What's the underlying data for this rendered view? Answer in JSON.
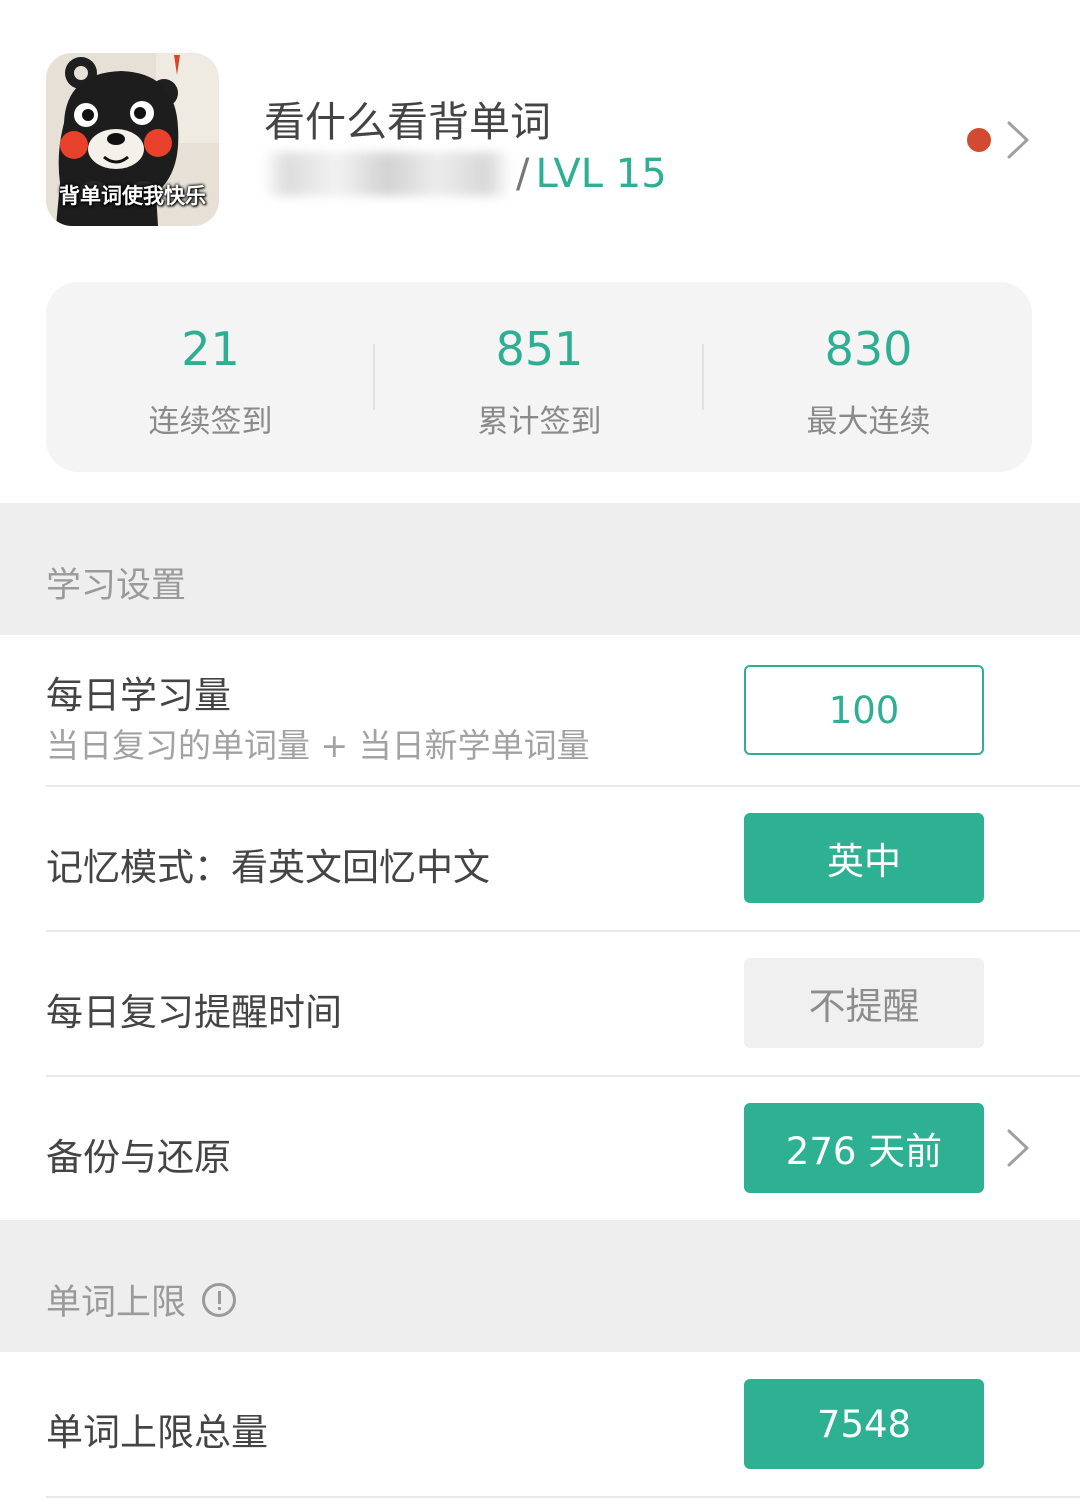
{
  "profile": {
    "avatar_caption": "背单词使我快乐",
    "nickname": "看什么看背单词",
    "level_separator": "/",
    "level": "LVL 15"
  },
  "stats": [
    {
      "value": "21",
      "label": "连续签到"
    },
    {
      "value": "851",
      "label": "累计签到"
    },
    {
      "value": "830",
      "label": "最大连续"
    }
  ],
  "study_settings": {
    "section_title": "学习设置",
    "daily_amount": {
      "label": "每日学习量",
      "sublabel": "当日复习的单词量 + 当日新学单词量",
      "value": "100"
    },
    "memory_mode": {
      "label": "记忆模式：看英文回忆中文",
      "value": "英中"
    },
    "review_reminder": {
      "label": "每日复习提醒时间",
      "value": "不提醒"
    },
    "backup_restore": {
      "label": "备份与还原",
      "value": "276 天前"
    }
  },
  "word_limit": {
    "section_title": "单词上限",
    "total": {
      "label": "单词上限总量",
      "value": "7548"
    }
  },
  "colors": {
    "accent": "#2eb193",
    "notify_dot": "#d24a31",
    "section_bg": "#eeeeee"
  }
}
